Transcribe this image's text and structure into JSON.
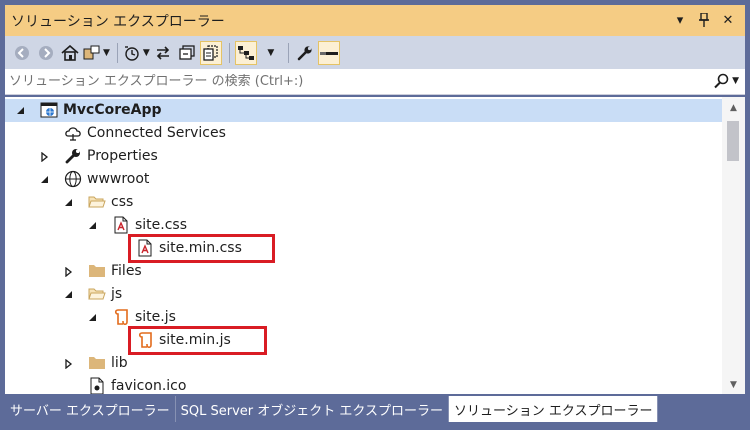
{
  "panel": {
    "title": "ソリューション エクスプローラー",
    "dropdown_glyph": "▾",
    "pin_glyph": "🖈",
    "close_glyph": "✕"
  },
  "search": {
    "placeholder": "ソリューション エクスプローラー の検索 (Ctrl+:)"
  },
  "tree": {
    "items": [
      {
        "label": "MvcCoreApp",
        "expand": "expanded",
        "icon": "solution-project-icon",
        "bold": true,
        "selected": true
      },
      {
        "label": "Connected Services",
        "expand": "none",
        "icon": "connected-services-icon"
      },
      {
        "label": "Properties",
        "expand": "collapsed",
        "icon": "wrench-icon"
      },
      {
        "label": "wwwroot",
        "expand": "expanded",
        "icon": "globe-icon"
      },
      {
        "label": "css",
        "expand": "expanded",
        "icon": "folder-open-icon"
      },
      {
        "label": "site.css",
        "expand": "expanded",
        "icon": "css-file-icon"
      },
      {
        "label": "site.min.css",
        "expand": "none",
        "icon": "css-file-icon",
        "highlighted": true
      },
      {
        "label": "Files",
        "expand": "collapsed",
        "icon": "folder-icon"
      },
      {
        "label": "js",
        "expand": "expanded",
        "icon": "folder-open-icon"
      },
      {
        "label": "site.js",
        "expand": "expanded",
        "icon": "js-file-icon"
      },
      {
        "label": "site.min.js",
        "expand": "none",
        "icon": "js-file-icon",
        "highlighted": true
      },
      {
        "label": "lib",
        "expand": "collapsed",
        "icon": "folder-icon"
      },
      {
        "label": "favicon.ico",
        "expand": "none",
        "icon": "image-file-icon"
      }
    ]
  },
  "tabs": [
    {
      "label": "サーバー エクスプローラー",
      "active": false
    },
    {
      "label": "SQL Server オブジェクト エクスプローラー",
      "active": false
    },
    {
      "label": "ソリューション エクスプローラー",
      "active": true
    }
  ],
  "colors": {
    "title_bar": "#f5cc84",
    "toolbar": "#cfd6e5",
    "frame": "#5d6b99",
    "selection": "#c9ddf6",
    "highlight_box": "#d91c24"
  }
}
